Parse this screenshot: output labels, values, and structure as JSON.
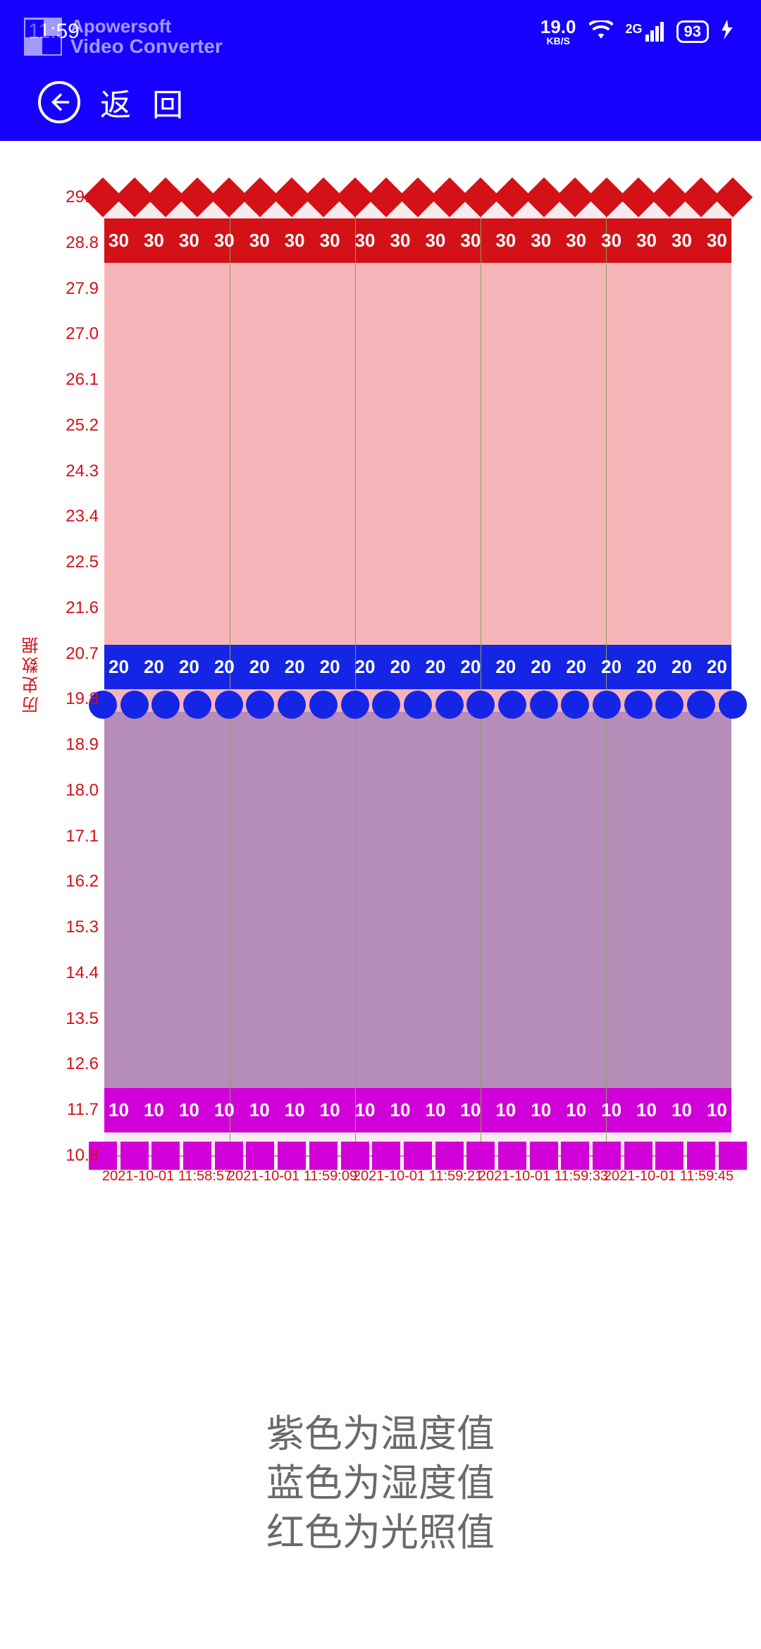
{
  "status": {
    "time": "11:59",
    "net": "19.0",
    "net_unit": "KB/S",
    "signal": "2G",
    "battery": "93"
  },
  "watermark": {
    "line1": "Apowersoft",
    "line2": "Video Converter"
  },
  "header": {
    "back_label": "返回"
  },
  "chart_data": {
    "type": "line",
    "ylabel": "历史数据",
    "ylim": [
      10.8,
      29.7
    ],
    "yticks": [
      "29.7",
      "28.8",
      "27.9",
      "27.0",
      "26.1",
      "25.2",
      "24.3",
      "23.4",
      "22.5",
      "21.6",
      "20.7",
      "19.8",
      "18.9",
      "18.0",
      "17.1",
      "16.2",
      "15.3",
      "14.4",
      "13.5",
      "12.6",
      "11.7",
      "10.8"
    ],
    "xticks": [
      "2021-10-01  11:58:57",
      "2021-10-01  11:59:09",
      "2021-10-01  11:59:21",
      "2021-10-01  11:59:33",
      "2021-10-01  11:59:45"
    ],
    "series": [
      {
        "name": "光照值",
        "color": "#d31117",
        "value": 30,
        "labels": [
          "30",
          "30",
          "30",
          "30",
          "30",
          "30",
          "30",
          "30",
          "30",
          "30",
          "30",
          "30",
          "30",
          "30",
          "30",
          "30",
          "30",
          "30"
        ]
      },
      {
        "name": "湿度值",
        "color": "#1425e5",
        "value": 20,
        "labels": [
          "20",
          "20",
          "20",
          "20",
          "20",
          "20",
          "20",
          "20",
          "20",
          "20",
          "20",
          "20",
          "20",
          "20",
          "20",
          "20",
          "20",
          "20"
        ]
      },
      {
        "name": "温度值",
        "color": "#d200d8",
        "value": 10,
        "labels": [
          "10",
          "10",
          "10",
          "10",
          "10",
          "10",
          "10",
          "10",
          "10",
          "10",
          "10",
          "10",
          "10",
          "10",
          "10",
          "10",
          "10",
          "10"
        ]
      }
    ]
  },
  "legend": {
    "l1": "紫色为温度值",
    "l2": "蓝色为湿度值",
    "l3": "红色为光照值"
  }
}
